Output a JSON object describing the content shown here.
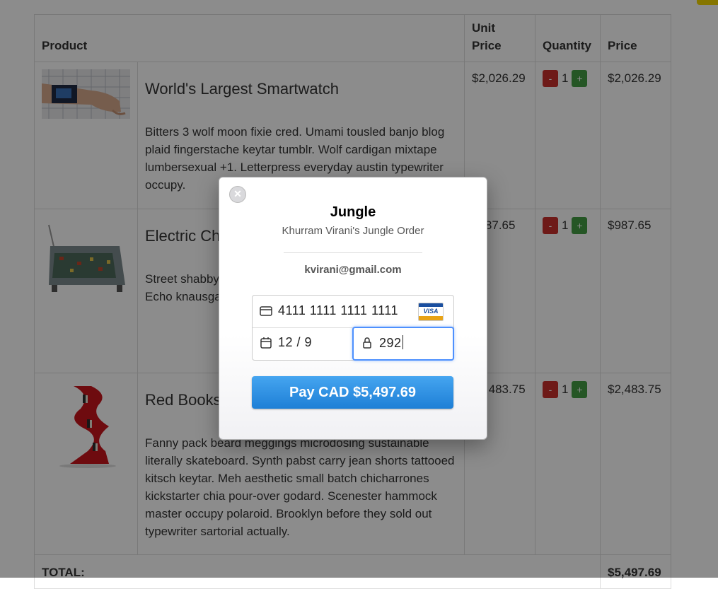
{
  "table": {
    "headers": {
      "product": "Product",
      "unit_price": "Unit Price",
      "quantity": "Quantity",
      "price": "Price"
    },
    "rows": [
      {
        "name": "World's Largest Smartwatch",
        "description": "Bitters 3 wolf moon fixie cred. Umami tousled banjo blog plaid fingerstache keytar tumblr. Wolf cardigan mixtape lumbersexual +1. Letterpress everyday austin typewriter occupy.",
        "unit_price": "$2,026.29",
        "quantity": "1",
        "price": "$2,026.29"
      },
      {
        "name": "Electric Chair",
        "description": "Street shabby chic shoreditch pickled schlitz hammock. Echo knausgaard quinoa.",
        "unit_price": "$987.65",
        "quantity": "1",
        "price": "$987.65"
      },
      {
        "name": "Red Bookshelf",
        "description": "Fanny pack beard meggings microdosing sustainable literally skateboard. Synth pabst carry jean shorts tattooed kitsch keytar. Meh aesthetic small batch chicharrones kickstarter chia pour-over godard. Scenester hammock master occupy polaroid. Brooklyn before they sold out typewriter sartorial actually.",
        "unit_price": "$2,483.75",
        "quantity": "1",
        "price": "$2,483.75"
      }
    ],
    "minus_label": "-",
    "plus_label": "+",
    "total_label": "TOTAL:",
    "total_value": "$5,497.69"
  },
  "checkout": {
    "close_symbol": "✕",
    "title": "Jungle",
    "subtitle": "Khurram Virani's Jungle Order",
    "email": "kvirani@gmail.com",
    "card_number": "4111 1111 1111 1111",
    "card_brand": "VISA",
    "expiry": "12 / 9",
    "cvc": "292",
    "pay_label": "Pay CAD $5,497.69",
    "accent_color": "#2b8fe5"
  }
}
